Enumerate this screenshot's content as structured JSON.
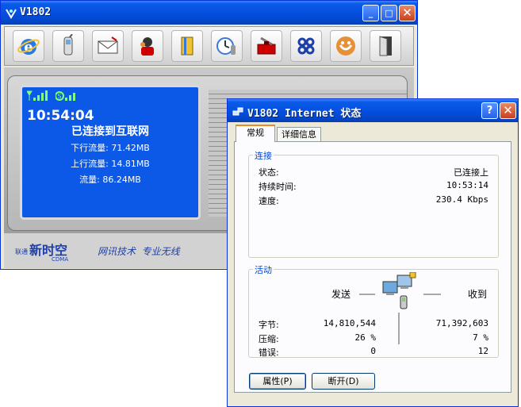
{
  "main_window": {
    "title": "V1802",
    "controls": {
      "minimize": "_",
      "maximize": "□",
      "close": "✕"
    },
    "toolbar": [
      {
        "icon": "internet-explorer-icon"
      },
      {
        "icon": "mobile-phone-icon"
      },
      {
        "icon": "envelope-icon"
      },
      {
        "icon": "contacts-icon"
      },
      {
        "icon": "book-icon"
      },
      {
        "icon": "clock-icon"
      },
      {
        "icon": "toolbox-icon"
      },
      {
        "icon": "china-unicom-icon"
      },
      {
        "icon": "qq-icon"
      },
      {
        "icon": "exit-door-icon"
      }
    ],
    "screen": {
      "time": "10:54:04",
      "status": "已连接到互联网",
      "download": "下行流量: 71.42MB",
      "upload": "上行流量: 14.81MB",
      "total": "流量: 86.24MB"
    },
    "footer": {
      "brand_small": "联通",
      "brand": "新时空",
      "brand_sub": "CDMA",
      "slogan": "网讯技术  专业无线"
    }
  },
  "status_window": {
    "title": "V1802 Internet 状态",
    "controls": {
      "help": "?",
      "close": "✕"
    },
    "tabs": [
      {
        "label": "常规"
      },
      {
        "label": "详细信息"
      }
    ],
    "connection": {
      "group_label": "连接",
      "rows": [
        {
          "label": "状态:",
          "value": "已连接上"
        },
        {
          "label": "持续时间:",
          "value": "10:53:14"
        },
        {
          "label": "速度:",
          "value": "230.4 Kbps"
        }
      ]
    },
    "activity": {
      "group_label": "活动",
      "sent_label": "发送",
      "received_label": "收到",
      "rows": [
        {
          "label": "字节:",
          "sent": "14,810,544",
          "received": "71,392,603"
        },
        {
          "label": "压缩:",
          "sent": "26 %",
          "received": "7 %"
        },
        {
          "label": "错误:",
          "sent": "0",
          "received": "12"
        }
      ]
    },
    "buttons": {
      "properties": "属性(P)",
      "disconnect": "断开(D)"
    }
  }
}
